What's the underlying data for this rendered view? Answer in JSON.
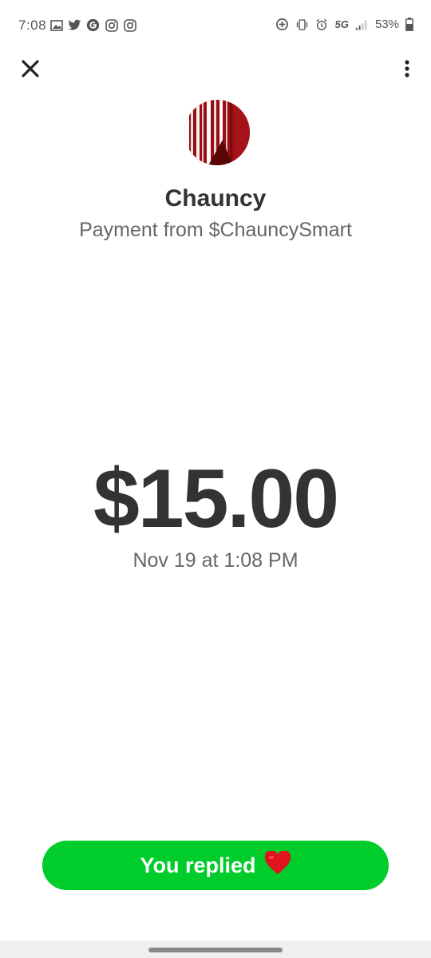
{
  "status_bar": {
    "time": "7:08",
    "battery_percent": "53%",
    "network": "5G",
    "left_icons": [
      "gallery-icon",
      "twitter-icon",
      "google-icon",
      "instagram-icon",
      "instagram-icon"
    ],
    "right_icons": [
      "data-saver-icon",
      "vibrate-icon",
      "alarm-icon",
      "5g-icon",
      "signal-icon",
      "battery-icon"
    ]
  },
  "header": {
    "close_icon": "close-icon",
    "more_icon": "more-vertical-icon"
  },
  "payment": {
    "name": "Chauncy",
    "subtitle": "Payment from $ChauncySmart",
    "amount": "$15.00",
    "date": "Nov 19 at 1:08 PM"
  },
  "reply_button": {
    "label": "You replied",
    "emoji": "❤️"
  },
  "colors": {
    "accent_green": "#00cc2b",
    "text_dark": "#333333",
    "text_muted": "#666666",
    "avatar_red": "#9b0d12"
  }
}
